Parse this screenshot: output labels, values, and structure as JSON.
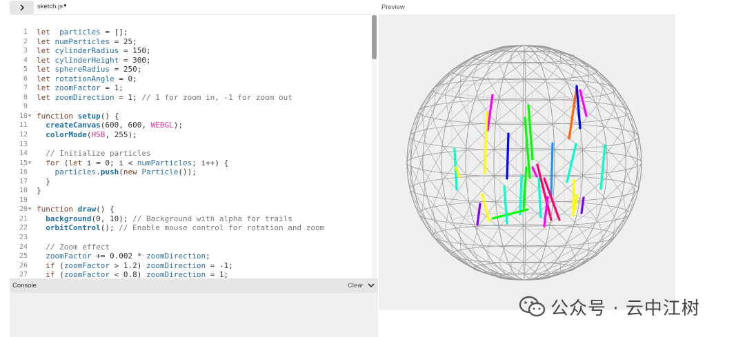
{
  "topbar": {
    "file_name": "sketch.js",
    "unsaved_marker": "●",
    "preview_label": "Preview"
  },
  "editor": {
    "lines": [
      {
        "n": "1",
        "fold": "",
        "tokens": [
          [
            "kw",
            "let"
          ],
          [
            "",
            "  "
          ],
          [
            "vr",
            "particles"
          ],
          [
            "",
            " = [];"
          ]
        ]
      },
      {
        "n": "2",
        "fold": "",
        "tokens": [
          [
            "kw",
            "let"
          ],
          [
            "",
            " "
          ],
          [
            "vr",
            "numParticles"
          ],
          [
            "",
            " = 25;"
          ]
        ]
      },
      {
        "n": "3",
        "fold": "",
        "tokens": [
          [
            "kw",
            "let"
          ],
          [
            "",
            " "
          ],
          [
            "vr",
            "cylinderRadius"
          ],
          [
            "",
            " = 150;"
          ]
        ]
      },
      {
        "n": "4",
        "fold": "",
        "tokens": [
          [
            "kw",
            "let"
          ],
          [
            "",
            " "
          ],
          [
            "vr",
            "cylinderHeight"
          ],
          [
            "",
            " = 300;"
          ]
        ]
      },
      {
        "n": "5",
        "fold": "",
        "tokens": [
          [
            "kw",
            "let"
          ],
          [
            "",
            " "
          ],
          [
            "vr",
            "sphereRadius"
          ],
          [
            "",
            " = 250;"
          ]
        ]
      },
      {
        "n": "6",
        "fold": "",
        "tokens": [
          [
            "kw",
            "let"
          ],
          [
            "",
            " "
          ],
          [
            "vr",
            "rotationAngle"
          ],
          [
            "",
            " = 0;"
          ]
        ]
      },
      {
        "n": "7",
        "fold": "",
        "tokens": [
          [
            "kw",
            "let"
          ],
          [
            "",
            " "
          ],
          [
            "vr",
            "zoomFactor"
          ],
          [
            "",
            " = 1;"
          ]
        ]
      },
      {
        "n": "8",
        "fold": "",
        "tokens": [
          [
            "kw",
            "let"
          ],
          [
            "",
            " "
          ],
          [
            "vr",
            "zoomDirection"
          ],
          [
            "",
            " = 1; "
          ],
          [
            "cm",
            "// 1 for zoom in, -1 for zoom out"
          ]
        ]
      },
      {
        "n": "9",
        "fold": "",
        "tokens": []
      },
      {
        "n": "10",
        "fold": "▼",
        "tokens": [
          [
            "kw",
            "function"
          ],
          [
            "",
            " "
          ],
          [
            "fn",
            "setup"
          ],
          [
            "",
            "() {"
          ]
        ]
      },
      {
        "n": "11",
        "fold": "",
        "tokens": [
          [
            "",
            "  "
          ],
          [
            "fn",
            "createCanvas"
          ],
          [
            "",
            "(600, 600, "
          ],
          [
            "const",
            "WEBGL"
          ],
          [
            "",
            ");"
          ]
        ]
      },
      {
        "n": "12",
        "fold": "",
        "tokens": [
          [
            "",
            "  "
          ],
          [
            "fn",
            "colorMode"
          ],
          [
            "",
            "("
          ],
          [
            "const",
            "HSB"
          ],
          [
            "",
            ", 255);"
          ]
        ]
      },
      {
        "n": "13",
        "fold": "",
        "tokens": []
      },
      {
        "n": "14",
        "fold": "",
        "tokens": [
          [
            "",
            "  "
          ],
          [
            "cm",
            "// Initialize particles"
          ]
        ]
      },
      {
        "n": "15",
        "fold": "▼",
        "tokens": [
          [
            "",
            "  "
          ],
          [
            "kw",
            "for"
          ],
          [
            "",
            " ("
          ],
          [
            "kw",
            "let"
          ],
          [
            "",
            " i = 0; i < "
          ],
          [
            "vr",
            "numParticles"
          ],
          [
            "",
            "; i++) {"
          ]
        ]
      },
      {
        "n": "16",
        "fold": "",
        "tokens": [
          [
            "",
            "    "
          ],
          [
            "vr",
            "particles"
          ],
          [
            "",
            "."
          ],
          [
            "fn",
            "push"
          ],
          [
            "",
            "("
          ],
          [
            "kw",
            "new"
          ],
          [
            "",
            " "
          ],
          [
            "cls",
            "Particle"
          ],
          [
            "",
            "());"
          ]
        ]
      },
      {
        "n": "17",
        "fold": "",
        "tokens": [
          [
            "",
            "  }"
          ]
        ]
      },
      {
        "n": "18",
        "fold": "",
        "tokens": [
          [
            "",
            "}"
          ]
        ]
      },
      {
        "n": "19",
        "fold": "",
        "tokens": []
      },
      {
        "n": "20",
        "fold": "▼",
        "tokens": [
          [
            "kw",
            "function"
          ],
          [
            "",
            " "
          ],
          [
            "fn",
            "draw"
          ],
          [
            "",
            "() {"
          ]
        ]
      },
      {
        "n": "21",
        "fold": "",
        "tokens": [
          [
            "",
            "  "
          ],
          [
            "fn",
            "background"
          ],
          [
            "",
            "(0, 10); "
          ],
          [
            "cm",
            "// Background with alpha for trails"
          ]
        ]
      },
      {
        "n": "22",
        "fold": "",
        "tokens": [
          [
            "",
            "  "
          ],
          [
            "fn",
            "orbitControl"
          ],
          [
            "",
            "(); "
          ],
          [
            "cm",
            "// Enable mouse control for rotation and zoom"
          ]
        ]
      },
      {
        "n": "23",
        "fold": "",
        "tokens": []
      },
      {
        "n": "24",
        "fold": "",
        "tokens": [
          [
            "",
            "  "
          ],
          [
            "cm",
            "// Zoom effect"
          ]
        ]
      },
      {
        "n": "25",
        "fold": "",
        "tokens": [
          [
            "",
            "  "
          ],
          [
            "vr",
            "zoomFactor"
          ],
          [
            "",
            " += 0.002 * "
          ],
          [
            "vr",
            "zoomDirection"
          ],
          [
            "",
            ";"
          ]
        ]
      },
      {
        "n": "26",
        "fold": "",
        "tokens": [
          [
            "",
            "  "
          ],
          [
            "kw",
            "if"
          ],
          [
            "",
            " ("
          ],
          [
            "vr",
            "zoomFactor"
          ],
          [
            "",
            " > 1.2) "
          ],
          [
            "vr",
            "zoomDirection"
          ],
          [
            "",
            " = -1;"
          ]
        ]
      },
      {
        "n": "27",
        "fold": "",
        "tokens": [
          [
            "",
            "  "
          ],
          [
            "kw",
            "if"
          ],
          [
            "",
            " ("
          ],
          [
            "vr",
            "zoomFactor"
          ],
          [
            "",
            " < 0.8) "
          ],
          [
            "vr",
            "zoomDirection"
          ],
          [
            "",
            " = 1;"
          ]
        ]
      }
    ]
  },
  "console": {
    "title": "Console",
    "clear_label": "Clear"
  },
  "preview": {
    "sphere_color": "#9a9a9a",
    "particle_colors": [
      "#ff00ff",
      "#ffff00",
      "#00ff00",
      "#00ffcc",
      "#0000ff",
      "#ff6600",
      "#1e90ff",
      "#ff0066",
      "#8000ff",
      "#00ff80"
    ]
  },
  "watermark": {
    "text": "公众号 · 云中江树",
    "icon": "wechat-icon"
  },
  "icons": {
    "toggle": "chevron-right-icon",
    "console_collapse": "chevron-down-icon"
  }
}
